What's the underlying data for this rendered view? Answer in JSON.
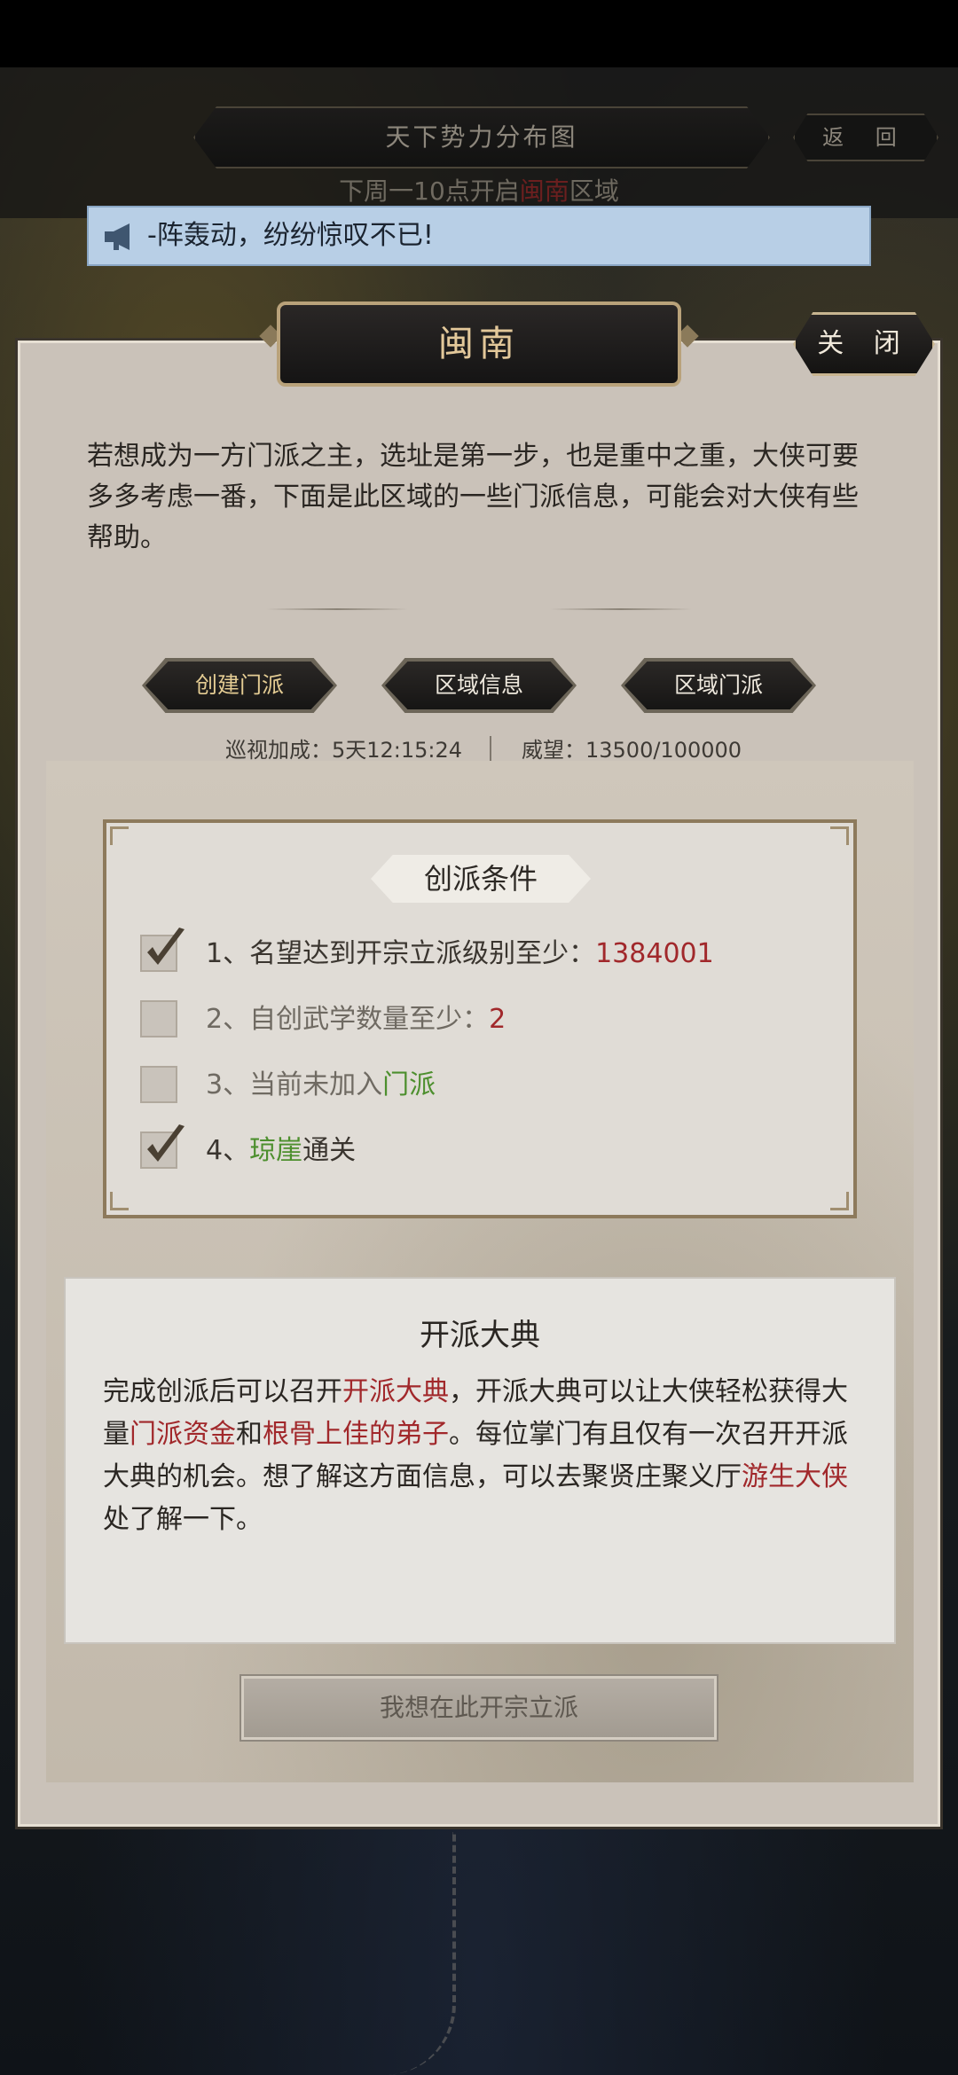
{
  "map": {
    "title": "天下势力分布图",
    "back_label": "返 回",
    "notice_prefix": "下周一10点开启",
    "notice_region": "闽南",
    "notice_suffix": "区域"
  },
  "marquee": {
    "text": "-阵轰动，纷纷惊叹不已!"
  },
  "panel": {
    "title": "闽南",
    "close_label": "关 闭",
    "intro": "若想成为一方门派之主，选址是第一步，也是重中之重，大侠可要多多考虑一番，下面是此区域的一些门派信息，可能会对大侠有些帮助。",
    "tabs": [
      {
        "label": "创建门派",
        "active": true
      },
      {
        "label": "区域信息",
        "active": false
      },
      {
        "label": "区域门派",
        "active": false
      }
    ],
    "stats": {
      "patrol": "巡视加成：5天12:15:24",
      "prestige": "威望：13500/100000"
    }
  },
  "conditions": {
    "title": "创派条件",
    "items": [
      {
        "checked": true,
        "prefix": "1、名望达到开宗立派级别至少：",
        "highlight": "1384001",
        "suffix": ""
      },
      {
        "checked": false,
        "prefix": "2、自创武学数量至少：",
        "highlight": "2",
        "suffix": ""
      },
      {
        "checked": false,
        "prefix": "3、当前未加入",
        "highlight": "门派",
        "suffix": ""
      },
      {
        "checked": true,
        "prefix": "4、",
        "highlight": "琼崖",
        "suffix": "通关"
      }
    ]
  },
  "ceremony": {
    "title": "开派大典",
    "p1": "完成创派后可以召开",
    "h1": "开派大典",
    "p2": "，开派大典可以让大侠轻松获得大量",
    "h2": "门派资金",
    "p3": "和",
    "h3": "根骨上佳的弟子",
    "p4": "。每位掌门有且仅有一次召开开派大典的机会。想了解这方面信息，可以去聚贤庄聚义厅",
    "h4": "游生大侠",
    "p5": "处了解一下。"
  },
  "action": {
    "found_label": "我想在此开宗立派"
  },
  "colors": {
    "highlight_red": "#a1282b",
    "highlight_green": "#4d8f2e",
    "title_gold": "#e3c89a",
    "marquee_bg": "#b8cfe6"
  }
}
